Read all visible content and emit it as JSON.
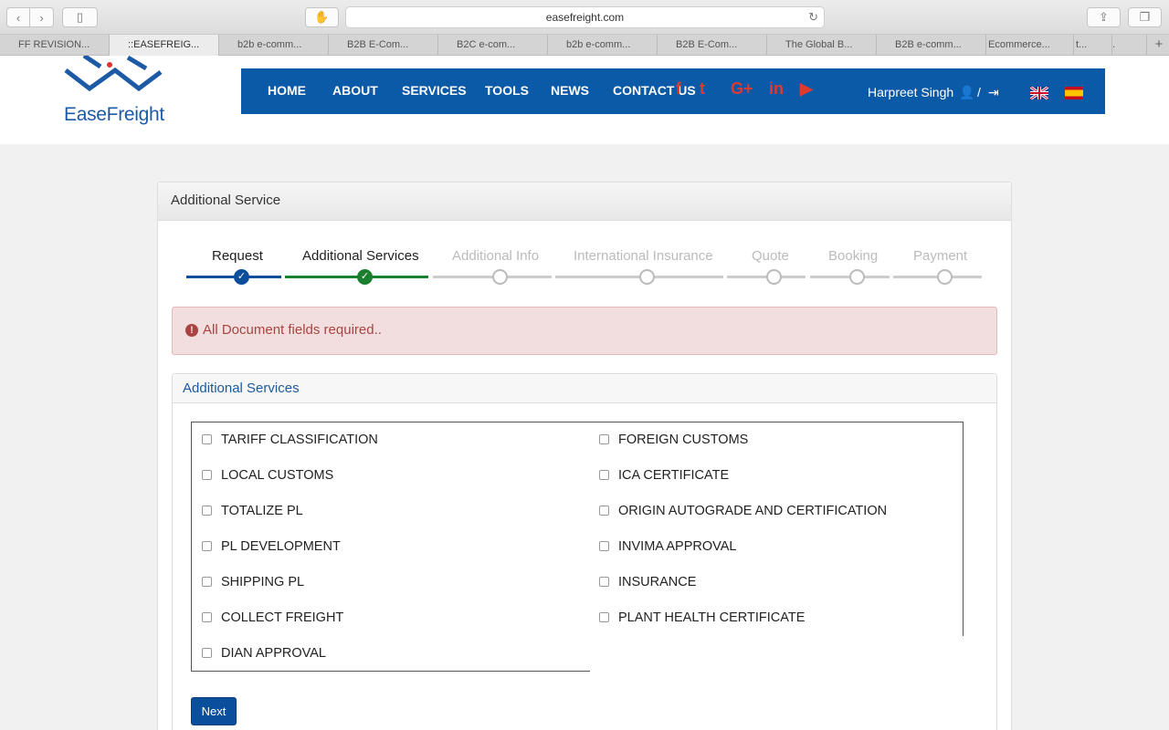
{
  "browser": {
    "url": "easefreight.com",
    "tabs": [
      "FF REVISION...",
      "::EASEFREIG...",
      "b2b e-comm...",
      "B2B E-Com...",
      "B2C e-com...",
      "b2b e-comm...",
      "B2B E-Com...",
      "The Global B...",
      "B2B e-comm...",
      "Ecommerce...",
      "t...",
      "."
    ]
  },
  "site": {
    "logo_text": "EaseFreight",
    "nav": [
      "HOME",
      "ABOUT",
      "SERVICES",
      "TOOLS",
      "NEWS",
      "CONTACT US"
    ],
    "social_icons": [
      "facebook-icon",
      "twitter-icon",
      "google-plus-icon",
      "linkedin-icon",
      "youtube-icon"
    ],
    "social_glyphs": [
      "f",
      "t",
      "G+",
      "in",
      "▶"
    ],
    "user_name": "Harpreet Singh",
    "slash": "/",
    "accent_color": "#0b5aa8"
  },
  "panel": {
    "title": "Additional Service",
    "steps": [
      {
        "label": "Request",
        "status": "done"
      },
      {
        "label": "Additional Services",
        "status": "done"
      },
      {
        "label": "Additional Info",
        "status": "pending"
      },
      {
        "label": "International Insurance",
        "status": "pending"
      },
      {
        "label": "Quote",
        "status": "pending"
      },
      {
        "label": "Booking",
        "status": "pending"
      },
      {
        "label": "Payment",
        "status": "pending"
      }
    ],
    "alert": "All Document fields required..",
    "sub_title": "Additional Services",
    "services_left": [
      "TARIFF CLASSIFICATION",
      "LOCAL CUSTOMS",
      "TOTALIZE PL",
      "PL DEVELOPMENT",
      "SHIPPING PL",
      "COLLECT FREIGHT",
      "DIAN APPROVAL"
    ],
    "services_right": [
      "FOREIGN CUSTOMS",
      "ICA CERTIFICATE",
      "ORIGIN AUTOGRADE AND CERTIFICATION",
      "INVIMA APPROVAL",
      "INSURANCE",
      "PLANT HEALTH CERTIFICATE"
    ],
    "next_label": "Next"
  }
}
